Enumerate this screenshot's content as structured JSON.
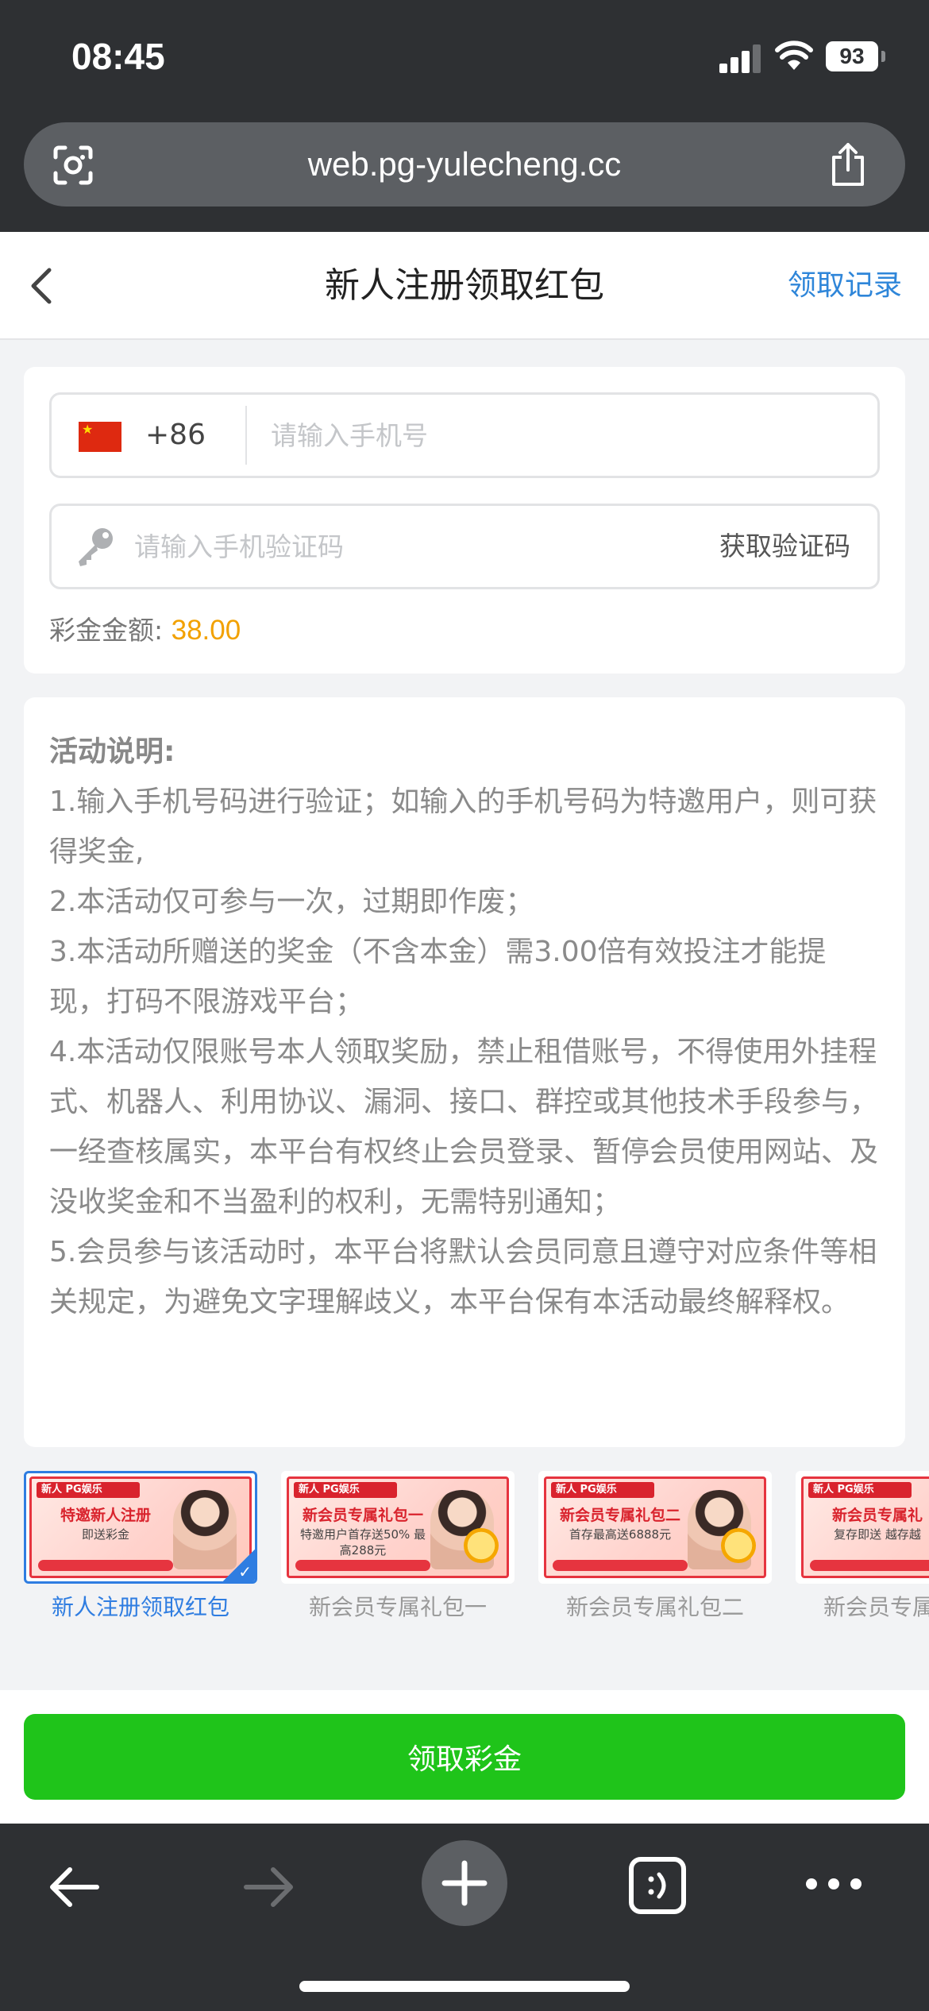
{
  "status_bar": {
    "time": "08:45",
    "battery": "93"
  },
  "browser": {
    "url": "web.pg-yulecheng.cc"
  },
  "header": {
    "title": "新人注册领取红包",
    "records_link": "领取记录"
  },
  "form": {
    "country_code": "+86",
    "phone_placeholder": "请输入手机号",
    "code_placeholder": "请输入手机验证码",
    "get_code_label": "获取验证码",
    "bonus_label": "彩金金额:",
    "bonus_value": "38.00"
  },
  "description": {
    "title": "活动说明:",
    "items": [
      "1.输入手机号码进行验证；如输入的手机号码为特邀用户，则可获得奖金,",
      "2.本活动仅可参与一次，过期即作废；",
      "3.本活动所赠送的奖金（不含本金）需3.00倍有效投注才能提现，打码不限游戏平台；",
      "4.本活动仅限账号本人领取奖励，禁止租借账号，不得使用外挂程式、机器人、利用协议、漏洞、接口、群控或其他技术手段参与，一经查核属实，本平台有权终止会员登录、暂停会员使用网站、及没收奖金和不当盈利的权利，无需特别通知；",
      "5.会员参与该活动时，本平台将默认会员同意且遵守对应条件等相关规定，为避免文字理解歧义，本平台保有本活动最终解释权。"
    ]
  },
  "banners": [
    {
      "label": "新人注册领取红包",
      "tag": "新人 PG娱乐",
      "headline": "特邀新人注册",
      "sub": "即送彩金",
      "active": true
    },
    {
      "label": "新会员专属礼包一",
      "tag": "新人 PG娱乐",
      "headline": "新会员专属礼包一",
      "sub": "特邀用户首存送50% 最高288元",
      "active": false
    },
    {
      "label": "新会员专属礼包二",
      "tag": "新人 PG娱乐",
      "headline": "新会员专属礼包二",
      "sub": "首存最高送6888元",
      "active": false
    },
    {
      "label": "新会员专属礼包三",
      "tag": "新人 PG娱乐",
      "headline": "新会员专属礼",
      "sub": "复存即送 越存越",
      "active": false
    }
  ],
  "claim_button": "领取彩金",
  "colors": {
    "accent_green": "#1fc41a",
    "link_blue": "#2f86d9",
    "bonus_orange": "#f2a100",
    "browser_dark": "#2e3033"
  },
  "icons": [
    "scan-icon",
    "share-icon",
    "back-icon",
    "china-flag-icon",
    "key-icon",
    "arrow-left-icon",
    "arrow-right-icon",
    "plus-icon",
    "tabs-icon",
    "more-icon"
  ]
}
